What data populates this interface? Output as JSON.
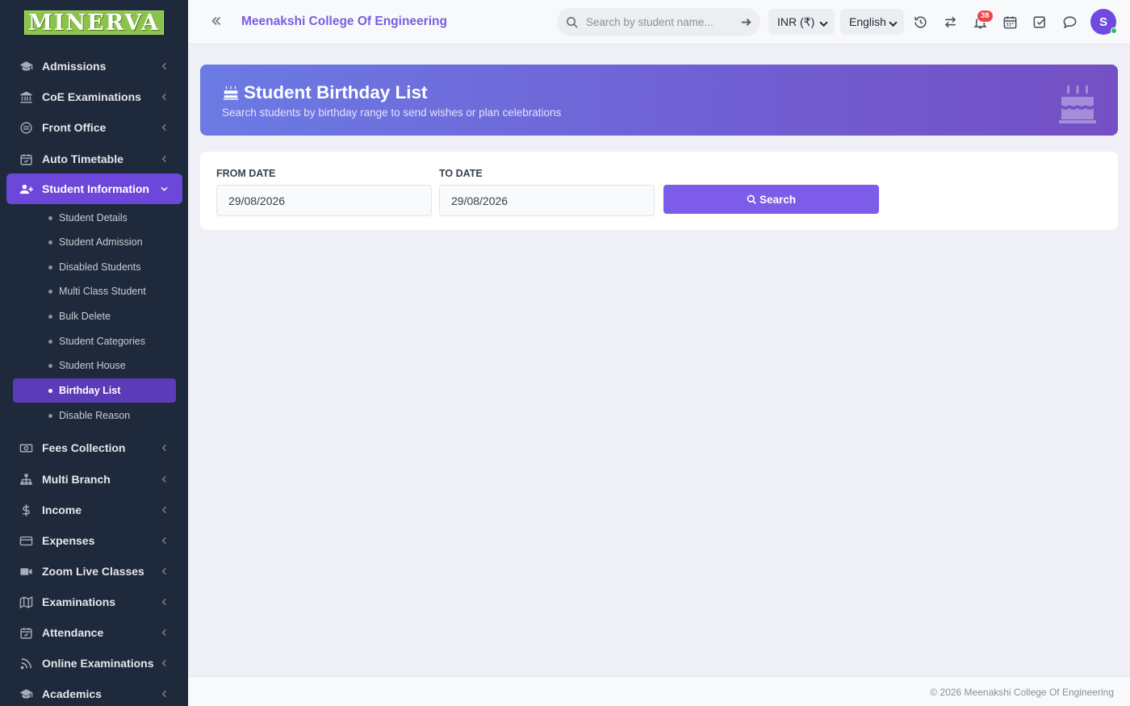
{
  "sidebar": {
    "logo": "MINERVA",
    "items": [
      {
        "label": "Admissions",
        "icon": "graduation-cap-icon"
      },
      {
        "label": "CoE Examinations",
        "icon": "university-icon"
      },
      {
        "label": "Front Office",
        "icon": "front-office-icon"
      },
      {
        "label": "Auto Timetable",
        "icon": "calendar-check-icon"
      },
      {
        "label": "Student Information",
        "icon": "user-plus-icon",
        "active": true
      },
      {
        "label": "Fees Collection",
        "icon": "money-bill-icon"
      },
      {
        "label": "Multi Branch",
        "icon": "sitemap-icon"
      },
      {
        "label": "Income",
        "icon": "dollar-icon"
      },
      {
        "label": "Expenses",
        "icon": "credit-card-icon"
      },
      {
        "label": "Zoom Live Classes",
        "icon": "video-icon"
      },
      {
        "label": "Examinations",
        "icon": "map-icon"
      },
      {
        "label": "Attendance",
        "icon": "calendar-check-icon"
      },
      {
        "label": "Online Examinations",
        "icon": "rss-icon"
      },
      {
        "label": "Academics",
        "icon": "graduation-cap-icon"
      }
    ],
    "subitems": [
      "Student Details",
      "Student Admission",
      "Disabled Students",
      "Multi Class Student",
      "Bulk Delete",
      "Student Categories",
      "Student House",
      "Birthday List",
      "Disable Reason"
    ],
    "active_subitem": "Birthday List"
  },
  "header": {
    "college": "Meenakshi College Of Engineering",
    "search_placeholder": "Search by student name...",
    "currency": "INR (₹)",
    "language": "English",
    "notification_count": "38",
    "avatar_initial": "S"
  },
  "hero": {
    "title": "Student Birthday List",
    "subtitle": "Search students by birthday range to send wishes or plan celebrations"
  },
  "filter": {
    "from_label": "FROM DATE",
    "from_value": "29/08/2026",
    "to_label": "TO DATE",
    "to_value": "29/08/2026",
    "search_label": "Search"
  },
  "footer": {
    "text": "© 2026 Meenakshi College Of Engineering"
  },
  "colors": {
    "accent": "#7c5ce8",
    "sidebar_bg": "#1e293b",
    "logo_bg": "#8bc34a",
    "badge": "#ef4444"
  }
}
